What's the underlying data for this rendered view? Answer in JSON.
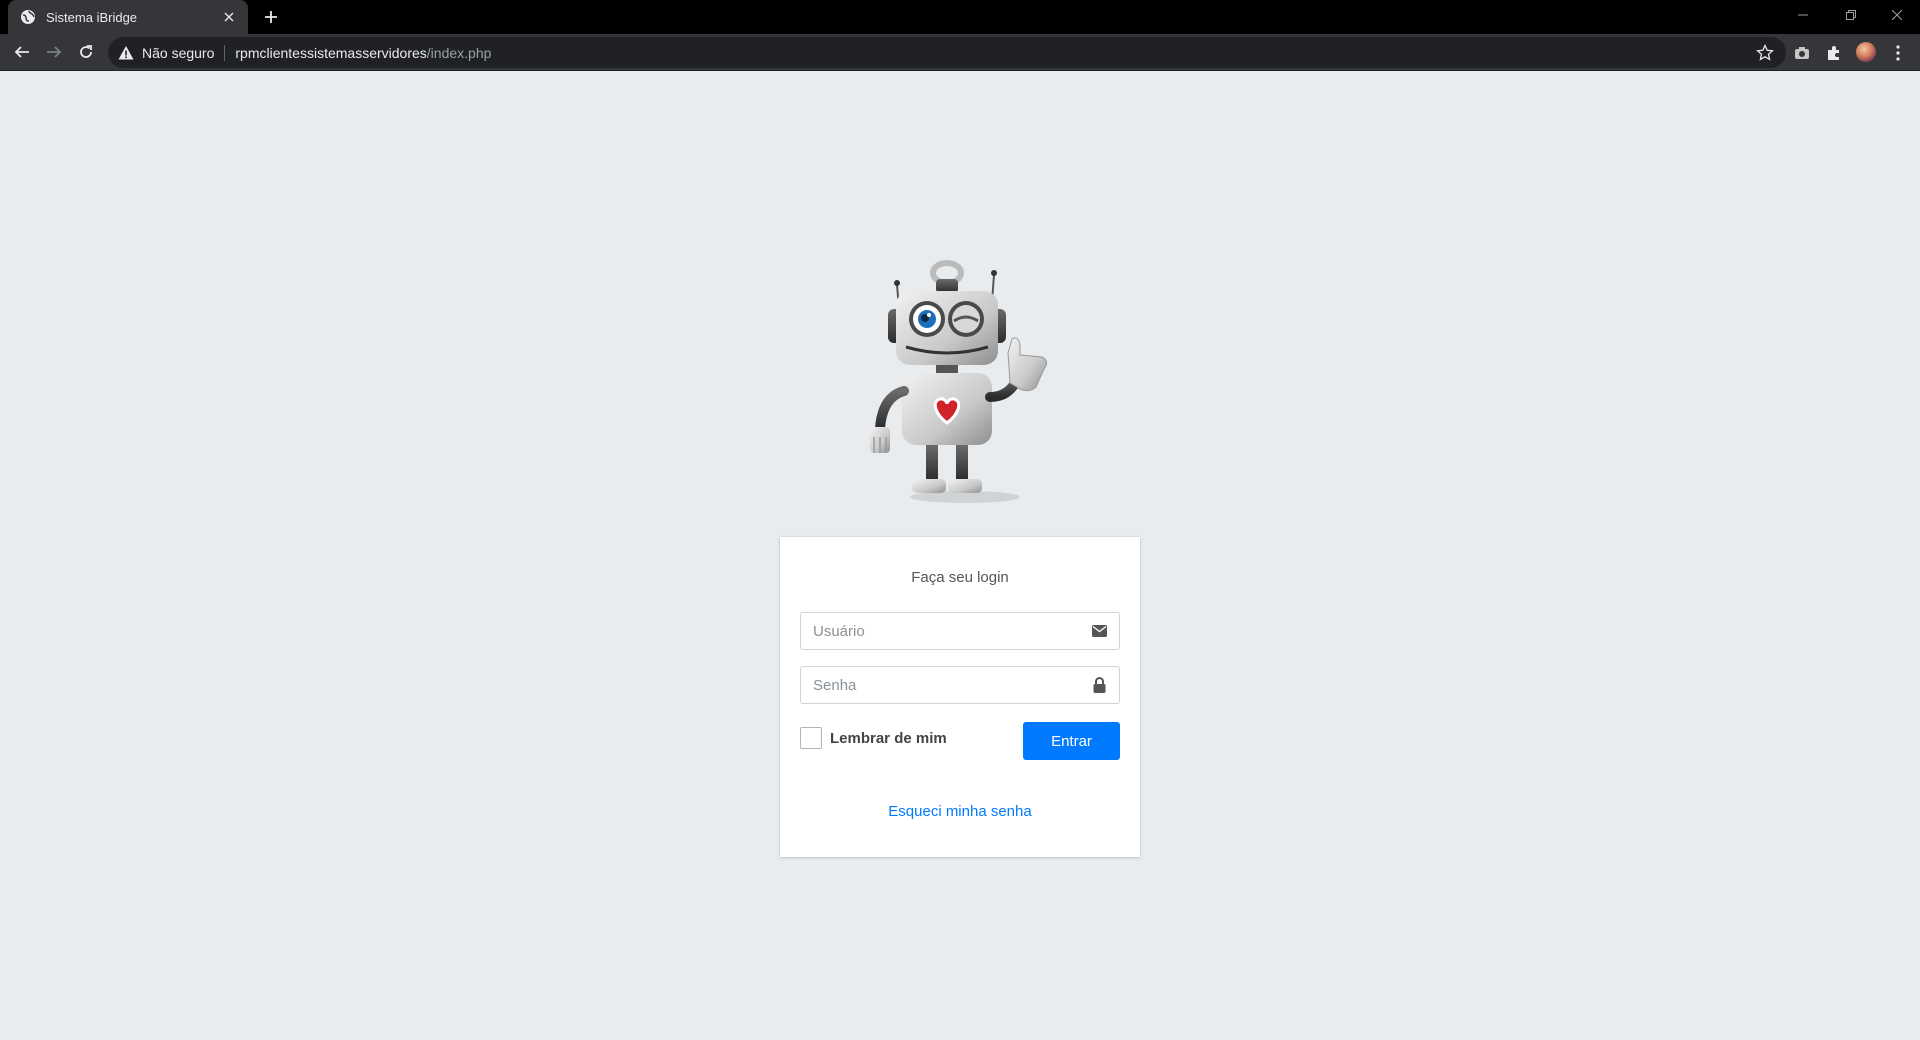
{
  "browser": {
    "tab_title": "Sistema iBridge",
    "security_label": "Não seguro",
    "url_host": "rpmclientessistemasservidores",
    "url_path": "/index.php"
  },
  "login": {
    "title": "Faça seu login",
    "username_placeholder": "Usuário",
    "password_placeholder": "Senha",
    "remember_label": "Lembrar de mim",
    "submit_label": "Entrar",
    "forgot_link": "Esqueci minha senha"
  },
  "colors": {
    "page_bg": "#e9ecef",
    "primary": "#007bff",
    "chrome_dark": "#35363a"
  }
}
